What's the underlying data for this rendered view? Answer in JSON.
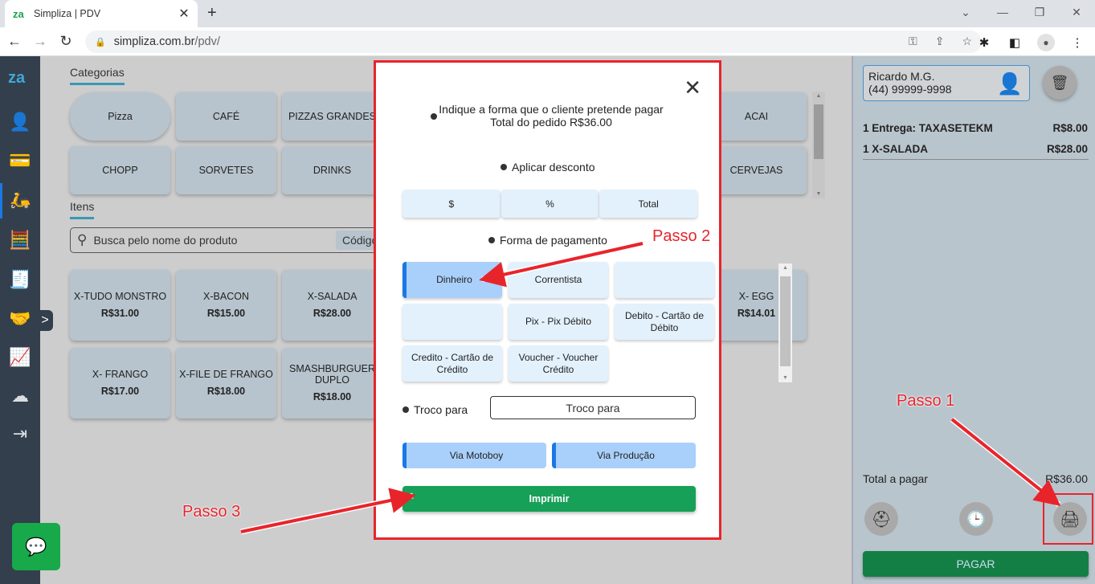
{
  "browser": {
    "tab_title": "Simpliza | PDV",
    "favicon": "za",
    "url_host": "simpliza.com.br",
    "url_path": "/pdv/",
    "window_controls": [
      "chevron-down",
      "minimize",
      "restore",
      "close"
    ]
  },
  "sidebar": {
    "logo": "za",
    "items": [
      {
        "name": "attendant",
        "icon": "👤"
      },
      {
        "name": "card",
        "icon": "💳"
      },
      {
        "name": "delivery",
        "icon": "🛵",
        "active": true
      },
      {
        "name": "cash-register",
        "icon": "🧮"
      },
      {
        "name": "invoice",
        "icon": "🧾"
      },
      {
        "name": "handshake",
        "icon": "🤝"
      },
      {
        "name": "reports",
        "icon": "📈"
      },
      {
        "name": "cloud-settings",
        "icon": "☁"
      },
      {
        "name": "logout",
        "icon": "⇥"
      }
    ],
    "expand_label": ">",
    "chat_icon": "💬"
  },
  "categories": {
    "title": "Categorias",
    "items": [
      "Pizza",
      "CAFÉ",
      "PIZZAS GRANDES",
      "ACAI",
      "CHOPP",
      "SORVETES",
      "DRINKS",
      "CERVEJAS"
    ]
  },
  "items_section": {
    "title": "Itens",
    "search_placeholder": "Busca pelo nome do produto",
    "codigo_label": "Código",
    "products": [
      {
        "name": "X-TUDO MONSTRO",
        "price": "R$31.00"
      },
      {
        "name": "X-BACON",
        "price": "R$15.00"
      },
      {
        "name": "X-SALADA",
        "price": "R$28.00"
      },
      {
        "name": "X- EGG",
        "price": "R$14.01"
      },
      {
        "name": "X- FRANGO",
        "price": "R$17.00"
      },
      {
        "name": "X-FILE DE FRANGO",
        "price": "R$18.00"
      },
      {
        "name": "SMASHBURGUER DUPLO",
        "price": "R$18.00"
      }
    ]
  },
  "cart": {
    "client_name": "Ricardo M.G.",
    "client_phone": "(44) 99999-9998",
    "lines": [
      {
        "desc": "1 Entrega: TAXASETEKM",
        "value": "R$8.00"
      },
      {
        "desc": "1 X-SALADA",
        "value": "R$28.00"
      }
    ],
    "total_label": "Total a pagar",
    "total_value": "R$36.00",
    "pay_label": "PAGAR"
  },
  "modal": {
    "intro_line1": "Indique a forma que o cliente pretende pagar",
    "intro_line2": "Total do pedido R$36.00",
    "discount_label": "Aplicar desconto",
    "discount_options": [
      "$",
      "%",
      "Total"
    ],
    "payment_label": "Forma de pagamento",
    "payment_methods": [
      "Dinheiro",
      "Correntista",
      "",
      "",
      "Pix - Pix Débito",
      "Debito - Cartão de Débito",
      "Credito - Cartão de Crédito",
      "Voucher - Voucher Crédito"
    ],
    "selected_payment": "Dinheiro",
    "troco_label": "Troco para",
    "troco_placeholder": "Troco para",
    "via_motoboy": "Via Motoboy",
    "via_producao": "Via Produção",
    "print_label": "Imprimir",
    "close_icon": "✕"
  },
  "annotations": {
    "step1": "Passo 1",
    "step2": "Passo 2",
    "step3": "Passo 3",
    "color": "#e8242b"
  }
}
